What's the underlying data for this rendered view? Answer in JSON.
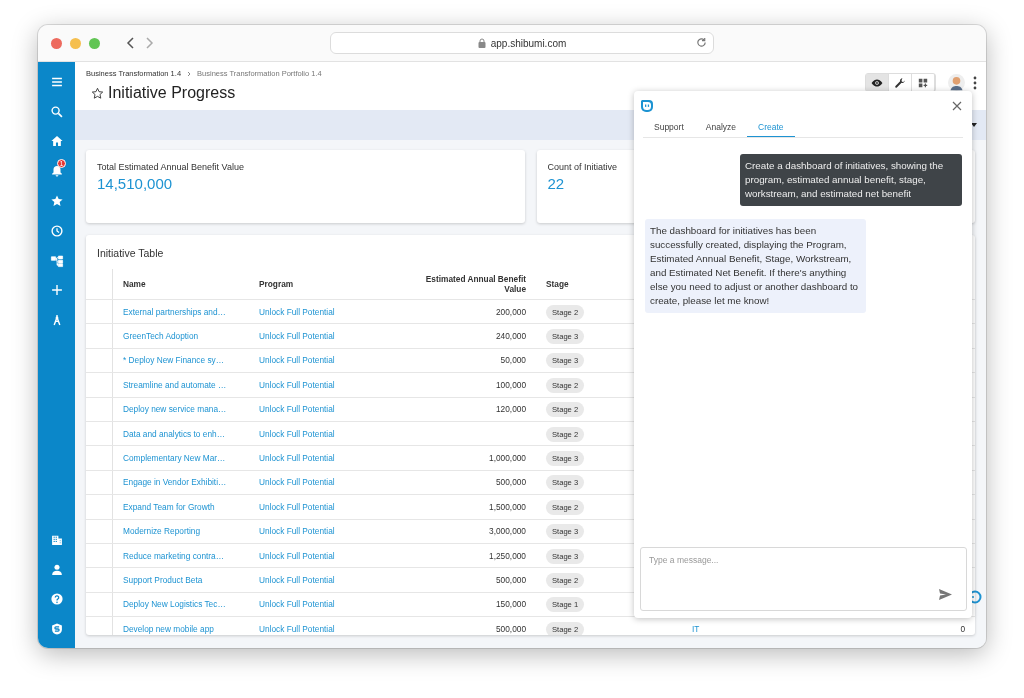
{
  "browser": {
    "url": "app.shibumi.com"
  },
  "sidebar": {
    "notification_badge": "1"
  },
  "breadcrumb": [
    {
      "label": "Business Transformation 1.4"
    },
    {
      "label": "Business Transformation Portfolio 1.4"
    }
  ],
  "page": {
    "title": "Initiative Progress",
    "favorite": false
  },
  "toolbar": [
    {
      "kind": "eye",
      "selected": true
    },
    {
      "kind": "wrench",
      "selected": false
    },
    {
      "kind": "grid",
      "selected": false
    }
  ],
  "metrics": [
    {
      "label": "Total Estimated Annual Benefit Value",
      "value": "14,510,000"
    },
    {
      "label": "Count of Initiative",
      "value": "22"
    }
  ],
  "table": {
    "title": "Initiative Table",
    "columns": [
      "Name",
      "Program",
      "Estimated Annual Benefit Value",
      "Stage"
    ],
    "rows": [
      {
        "name": "External partnerships and…",
        "program": "Unlock Full Potential",
        "value": "200,000",
        "stage": "Stage 2"
      },
      {
        "name": "GreenTech Adoption",
        "program": "Unlock Full Potential",
        "value": "240,000",
        "stage": "Stage 3"
      },
      {
        "name": "* Deploy New Finance sy…",
        "program": "Unlock Full Potential",
        "value": "50,000",
        "stage": "Stage 3"
      },
      {
        "name": "Streamline and automate …",
        "program": "Unlock Full Potential",
        "value": "100,000",
        "stage": "Stage 2"
      },
      {
        "name": "Deploy new service mana…",
        "program": "Unlock Full Potential",
        "value": "120,000",
        "stage": "Stage 2"
      },
      {
        "name": "Data and analytics to enh…",
        "program": "Unlock Full Potential",
        "stage": "Stage 2"
      },
      {
        "name": "Complementary New Mar…",
        "program": "Unlock Full Potential",
        "value": "1,000,000",
        "stage": "Stage 3"
      },
      {
        "name": "Engage in Vendor Exhibiti…",
        "program": "Unlock Full Potential",
        "value": "500,000",
        "stage": "Stage 3"
      },
      {
        "name": "Expand Team for Growth",
        "program": "Unlock Full Potential",
        "value": "1,500,000",
        "stage": "Stage 2"
      },
      {
        "name": "Modernize Reporting",
        "program": "Unlock Full Potential",
        "value": "3,000,000",
        "stage": "Stage 3"
      },
      {
        "name": "Reduce marketing contra…",
        "program": "Unlock Full Potential",
        "value": "1,250,000",
        "stage": "Stage 3"
      },
      {
        "name": "Support Product Beta",
        "program": "Unlock Full Potential",
        "value": "500,000",
        "stage": "Stage 2"
      },
      {
        "name": "Deploy New Logistics Tec…",
        "program": "Unlock Full Potential",
        "value": "150,000",
        "stage": "Stage 1"
      },
      {
        "name": "Develop new mobile app",
        "program": "Unlock Full Potential",
        "value": "500,000",
        "stage": "Stage 2",
        "column_5": "IT",
        "column_6": "0"
      }
    ]
  },
  "chat": {
    "tabs": [
      {
        "label": "Support",
        "selected": false
      },
      {
        "label": "Analyze",
        "selected": false
      },
      {
        "label": "Create",
        "selected": true
      }
    ],
    "messages": [
      {
        "kind": "user",
        "text": "Create a dashboard of initiatives, showing the program, estimated annual benefit, stage, workstream, and estimated net benefit"
      },
      {
        "kind": "assistant",
        "text": "The dashboard for initiatives has been successfully created, displaying the Program, Estimated Annual Benefit, Stage, Workstream, and Estimated Net Benefit. If there's anything else you need to adjust or another dashboard to create, please let me know!"
      }
    ],
    "input": {
      "placeholder": "Type a message..."
    }
  }
}
